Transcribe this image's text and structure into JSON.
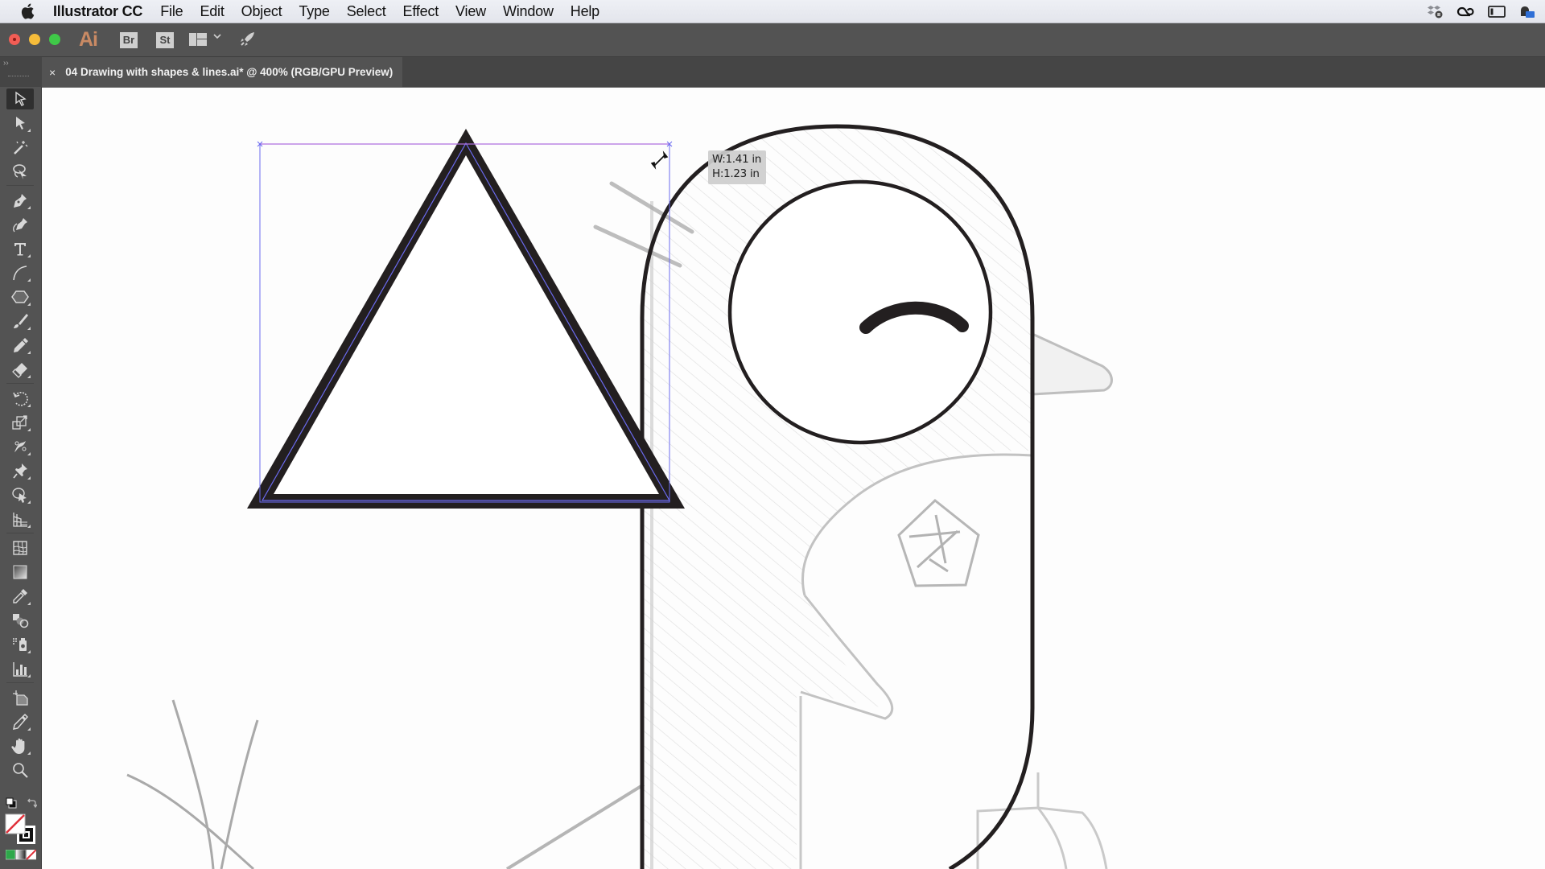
{
  "menubar": {
    "apple_icon": "apple-logo-icon",
    "app_name": "Illustrator CC",
    "items": [
      "File",
      "Edit",
      "Object",
      "Type",
      "Select",
      "Effect",
      "View",
      "Window",
      "Help"
    ],
    "status_icons": [
      "dropbox-paused-icon",
      "creative-cloud-icon",
      "display-icon",
      "user-switch-icon"
    ]
  },
  "appbar": {
    "logo": "Ai",
    "bridge": "Br",
    "stock": "St",
    "layout_icon": "workspace-layout-icon",
    "publish_icon": "rocket-icon"
  },
  "document_tab": {
    "close": "×",
    "title": "04 Drawing with shapes & lines.ai* @ 400% (RGB/GPU Preview)"
  },
  "toolbar": {
    "collapse": "››",
    "tools": [
      {
        "name": "selection-tool",
        "active": true
      },
      {
        "name": "direct-selection-tool"
      },
      {
        "name": "magic-wand-tool"
      },
      {
        "name": "lasso-tool"
      },
      {
        "name": "pen-tool"
      },
      {
        "name": "curvature-tool"
      },
      {
        "name": "type-tool"
      },
      {
        "name": "line-segment-tool"
      },
      {
        "name": "polygon-tool"
      },
      {
        "name": "paintbrush-tool"
      },
      {
        "name": "pencil-tool"
      },
      {
        "name": "eraser-tool"
      },
      {
        "name": "rotate-tool"
      },
      {
        "name": "scale-tool"
      },
      {
        "name": "puppet-warp-tool"
      },
      {
        "name": "pin-tool"
      },
      {
        "name": "shape-builder-tool"
      },
      {
        "name": "perspective-grid-tool"
      },
      {
        "name": "mesh-tool"
      },
      {
        "name": "gradient-tool"
      },
      {
        "name": "eyedropper-tool"
      },
      {
        "name": "blend-tool"
      },
      {
        "name": "symbol-sprayer-tool"
      },
      {
        "name": "column-graph-tool"
      },
      {
        "name": "artboard-tool"
      },
      {
        "name": "slice-tool"
      },
      {
        "name": "hand-tool"
      },
      {
        "name": "zoom-tool"
      }
    ],
    "fill": "none",
    "stroke": "#231f20"
  },
  "canvas": {
    "zoom_percent": 400,
    "color_mode": "RGB/GPU Preview",
    "selection_color": "#6b6bf0",
    "stroke_color": "#231f20",
    "transform_tooltip": {
      "width": "W:1.41 in",
      "height": "H:1.23 in"
    }
  }
}
